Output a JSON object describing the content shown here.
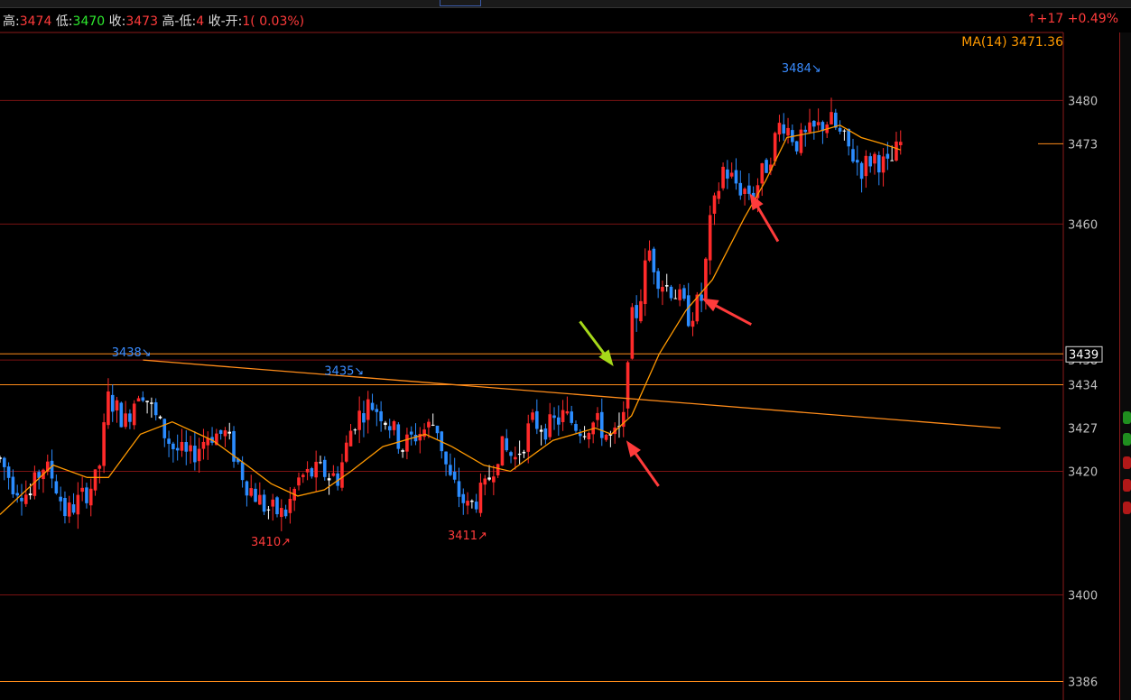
{
  "header": {
    "high_label": "高:",
    "high": "3474",
    "low_label": "低:",
    "low": "3470",
    "close_label": "收:",
    "close": "3473",
    "range_label": "高-低:",
    "range": "4",
    "diff_label": "收-开:",
    "diff": "1( 0.03%)",
    "change": "↑+17  +0.49%"
  },
  "chart_data": {
    "type": "candlestick",
    "ma_label": "MA(14) 3471.36",
    "ylim": [
      3383,
      3491
    ],
    "y_ticks": [
      3480,
      3473,
      3460,
      3439,
      3438,
      3434,
      3427,
      3420,
      3400,
      3386
    ],
    "current_price_marker": "3439",
    "horizontal_lines": [
      3480,
      3460,
      3439,
      3438,
      3434,
      3420,
      3400,
      3386
    ],
    "trendline": {
      "from": [
        0.1345,
        3438
      ],
      "to": [
        0.941,
        3427
      ]
    },
    "annotations": [
      {
        "text": "3438↘",
        "price": 3438,
        "at": 0.105,
        "color": "#3a8cff"
      },
      {
        "text": "3435↘",
        "price": 3435,
        "at": 0.305,
        "color": "#3a8cff"
      },
      {
        "text": "3484↘",
        "price": 3484,
        "at": 0.735,
        "color": "#3a8cff"
      },
      {
        "text": "3410↗",
        "price": 3410,
        "at": 0.236,
        "color": "#ff3b3b"
      },
      {
        "text": "3411↗",
        "price": 3411,
        "at": 0.421,
        "color": "#ff3b3b"
      }
    ],
    "waypoints": [
      [
        0,
        3422
      ],
      [
        0.012,
        3418
      ],
      [
        0.028,
        3416
      ],
      [
        0.04,
        3421
      ],
      [
        0.05,
        3419
      ],
      [
        0.062,
        3413
      ],
      [
        0.078,
        3416
      ],
      [
        0.092,
        3419
      ],
      [
        0.102,
        3432
      ],
      [
        0.118,
        3428
      ],
      [
        0.132,
        3434
      ],
      [
        0.145,
        3429
      ],
      [
        0.162,
        3424
      ],
      [
        0.178,
        3422
      ],
      [
        0.196,
        3426
      ],
      [
        0.212,
        3426
      ],
      [
        0.232,
        3418
      ],
      [
        0.25,
        3414
      ],
      [
        0.268,
        3413
      ],
      [
        0.282,
        3419
      ],
      [
        0.3,
        3420
      ],
      [
        0.318,
        3419
      ],
      [
        0.332,
        3428
      ],
      [
        0.348,
        3431
      ],
      [
        0.362,
        3429
      ],
      [
        0.378,
        3424
      ],
      [
        0.392,
        3426
      ],
      [
        0.41,
        3428
      ],
      [
        0.422,
        3419
      ],
      [
        0.44,
        3414
      ],
      [
        0.456,
        3417
      ],
      [
        0.47,
        3424
      ],
      [
        0.485,
        3422
      ],
      [
        0.5,
        3428
      ],
      [
        0.515,
        3427
      ],
      [
        0.53,
        3429
      ],
      [
        0.546,
        3427
      ],
      [
        0.56,
        3428
      ],
      [
        0.575,
        3425
      ],
      [
        0.586,
        3427
      ],
      [
        0.592,
        3444
      ],
      [
        0.6,
        3446
      ],
      [
        0.61,
        3456
      ],
      [
        0.62,
        3451
      ],
      [
        0.635,
        3449
      ],
      [
        0.648,
        3445
      ],
      [
        0.66,
        3448
      ],
      [
        0.668,
        3460
      ],
      [
        0.68,
        3469
      ],
      [
        0.695,
        3466
      ],
      [
        0.708,
        3465
      ],
      [
        0.722,
        3470
      ],
      [
        0.735,
        3477
      ],
      [
        0.75,
        3473
      ],
      [
        0.765,
        3475
      ],
      [
        0.78,
        3477
      ],
      [
        0.795,
        3473
      ],
      [
        0.81,
        3469
      ],
      [
        0.822,
        3471
      ],
      [
        0.835,
        3469
      ],
      [
        0.847,
        3473
      ]
    ],
    "ma_waypoints": [
      [
        0,
        3413
      ],
      [
        0.05,
        3421
      ],
      [
        0.082,
        3419
      ],
      [
        0.102,
        3419
      ],
      [
        0.132,
        3426
      ],
      [
        0.162,
        3428
      ],
      [
        0.2,
        3425
      ],
      [
        0.232,
        3421
      ],
      [
        0.255,
        3418
      ],
      [
        0.28,
        3416
      ],
      [
        0.305,
        3417
      ],
      [
        0.33,
        3420
      ],
      [
        0.36,
        3424
      ],
      [
        0.4,
        3426
      ],
      [
        0.425,
        3424
      ],
      [
        0.455,
        3421
      ],
      [
        0.48,
        3420
      ],
      [
        0.52,
        3425
      ],
      [
        0.56,
        3427
      ],
      [
        0.575,
        3426
      ],
      [
        0.594,
        3429
      ],
      [
        0.62,
        3439
      ],
      [
        0.645,
        3446
      ],
      [
        0.67,
        3451
      ],
      [
        0.7,
        3461
      ],
      [
        0.72,
        3467
      ],
      [
        0.74,
        3474
      ],
      [
        0.77,
        3475
      ],
      [
        0.79,
        3476
      ],
      [
        0.81,
        3474
      ],
      [
        0.83,
        3473
      ],
      [
        0.847,
        3472
      ]
    ],
    "arrows": [
      {
        "color": "#a6d81a",
        "tip": [
          0.577,
          3437
        ],
        "dir": [
          -0.6,
          -0.8
        ]
      },
      {
        "color": "#ff3b3b",
        "tip": [
          0.589,
          3425
        ],
        "dir": [
          0.6,
          0.85
        ]
      },
      {
        "color": "#ff3b3b",
        "tip": [
          0.66,
          3448
        ],
        "dir": [
          0.85,
          0.45
        ]
      },
      {
        "color": "#ff3b3b",
        "tip": [
          0.705,
          3465
        ],
        "dir": [
          0.5,
          0.85
        ]
      }
    ],
    "colors": {
      "up": "#ff2a2a",
      "down": "#2b8cff",
      "doji": "#ffffff",
      "ma": "#ff9900",
      "grid": "#7a1212",
      "level": "#ff8c1a",
      "axis": "#c0c0c0"
    }
  }
}
